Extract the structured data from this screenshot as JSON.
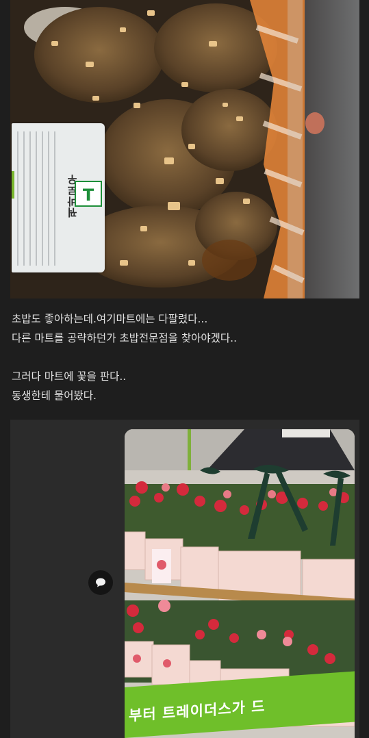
{
  "post": {
    "lines": [
      "초밥도 좋아하는데.여기마트에는 다팔렸다...",
      "다른 마트를 공략하던가 초밥전문점을 찾아야겠다..",
      "",
      "그러다 마트에 꽃을 판다..",
      "동생한테 물어봤다."
    ]
  },
  "photo_food": {
    "label_title": "꿔바로우",
    "label_logo": "T"
  },
  "photo_flowers": {
    "store_sign": "부터 트레이더스가 드"
  },
  "icons": {
    "comment": "comment-bubble-icon"
  },
  "colors": {
    "background": "#1e1e1e",
    "panel": "#2b2b2b",
    "text": "#e2e2e2",
    "sign_green": "#6fbf2a",
    "logo_green": "#1e8f3a"
  }
}
